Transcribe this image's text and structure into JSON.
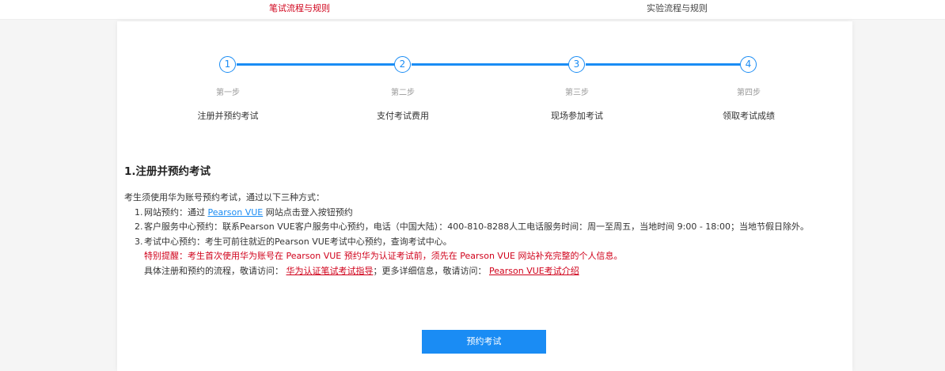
{
  "tabs": {
    "written": "笔试流程与规则",
    "lab": "实验流程与规则"
  },
  "steps": [
    {
      "number": "1",
      "sub": "第一步",
      "name": "注册并预约考试"
    },
    {
      "number": "2",
      "sub": "第二步",
      "name": "支付考试费用"
    },
    {
      "number": "3",
      "sub": "第三步",
      "name": "现场参加考试"
    },
    {
      "number": "4",
      "sub": "第四步",
      "name": "领取考试成绩"
    }
  ],
  "section": {
    "title": "1.注册并预约考试",
    "intro": "考生须使用华为账号预约考试，通过以下三种方式：",
    "items": [
      {
        "num": "1.",
        "prefix": "网站预约：通过 ",
        "link": "Pearson VUE",
        "suffix": " 网站点击登入按钮预约"
      },
      {
        "num": "2.",
        "text": "客户服务中心预约：联系Pearson VUE客户服务中心预约，电话（中国大陆）：400-810-8288人工电话服务时间：周一至周五，当地时间 9:00 - 18:00；当地节假日除外。"
      },
      {
        "num": "3.",
        "text": "考试中心预约：考生可前往就近的Pearson VUE考试中心预约，查询考试中心。"
      }
    ],
    "reminder": "特别提醒：考生首次使用华为账号在 Pearson VUE 预约华为认证考试前，须先在 Pearson VUE 网站补充完整的个人信息。",
    "links_line": {
      "prefix": "具体注册和预约的流程，敬请访问：",
      "link1": "华为认证笔试考试指导",
      "middle": "；更多详细信息，敬请访问：",
      "link2": "Pearson VUE考试介绍"
    }
  },
  "button": {
    "label": "预约考试"
  },
  "colors": {
    "accent": "#1a8cf4",
    "alert": "#d0021b"
  }
}
